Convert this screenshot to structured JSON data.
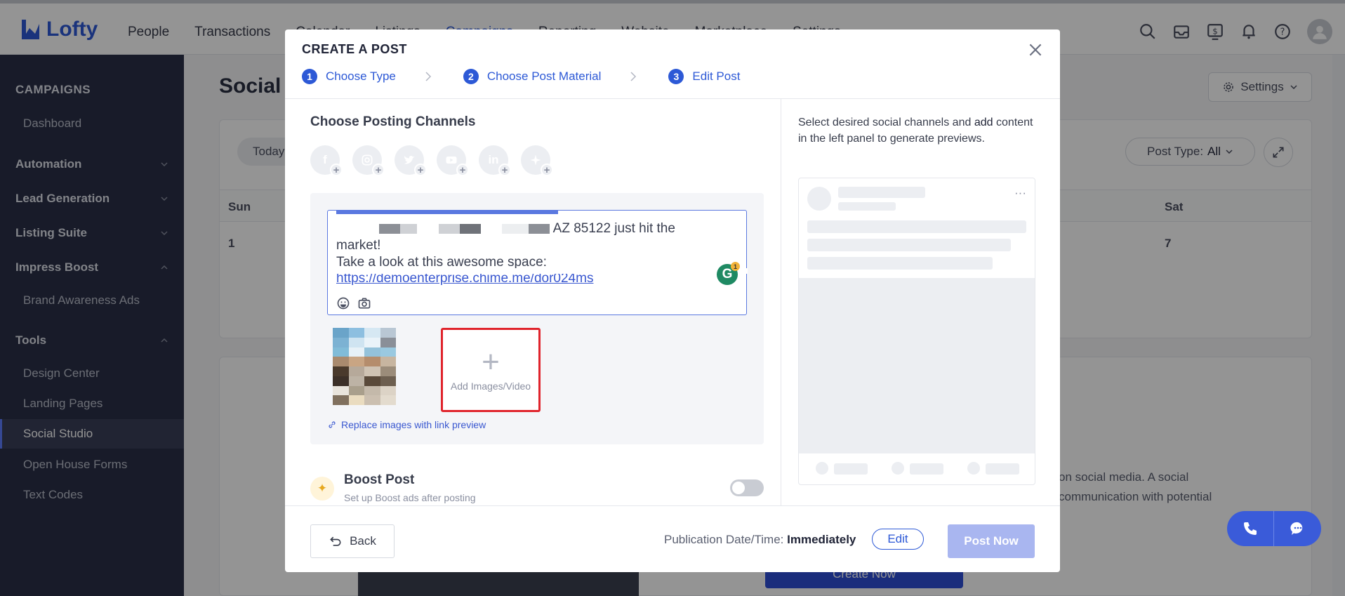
{
  "app": {
    "brand": "Lofty"
  },
  "nav": [
    "People",
    "Transactions",
    "Calendar",
    "Listings",
    "Campaigns",
    "Reporting",
    "Website",
    "Marketplace",
    "Settings"
  ],
  "sidebar": {
    "section": "CAMPAIGNS",
    "dashboard": "Dashboard",
    "automation": "Automation",
    "lead_generation": "Lead Generation",
    "listing_suite": "Listing Suite",
    "impress_boost": "Impress Boost",
    "brand_awareness": "Brand Awareness Ads",
    "tools": "Tools",
    "design_center": "Design Center",
    "landing_pages": "Landing Pages",
    "social_studio": "Social Studio",
    "open_house": "Open House Forms",
    "text_codes": "Text Codes"
  },
  "background": {
    "page_title": "Social",
    "settings": "Settings",
    "today": "Today",
    "post_type_label": "Post Type:",
    "post_type_value": "All",
    "day_sun": "Sun",
    "day_sat": "Sat",
    "date_1": "1",
    "date_7": "7",
    "desc_line1": "on social media. A social",
    "desc_line2": "communication with potential",
    "create_now": "Create Now"
  },
  "modal": {
    "title": "CREATE A POST",
    "steps": [
      {
        "num": "1",
        "label": "Choose Type"
      },
      {
        "num": "2",
        "label": "Choose Post Material"
      },
      {
        "num": "3",
        "label": "Edit Post"
      }
    ],
    "channels_title": "Choose Posting Channels",
    "post_text_tail": "AZ 85122 just hit the",
    "post_text_line2": "market!",
    "post_text_line3": "Take a look at this awesome space:",
    "post_link": "https://demoenterprise.chime.me/dor024ms",
    "grammarly_count": "1",
    "add_media": "Add Images/Video",
    "replace_link": "Replace images with link preview",
    "boost_title": "Boost Post",
    "boost_sub": "Set up Boost ads after posting",
    "right_info_pre": "Select desired social channels and ",
    "right_info_bold": "add",
    "right_info_post": " content in the left panel to generate previews.",
    "back": "Back",
    "pub_label": "Publication Date/Time: ",
    "pub_value": "Immediately",
    "edit": "Edit",
    "post_now": "Post Now"
  },
  "colors": {
    "accent": "#2d59d6",
    "highlight_red": "#e0242c",
    "sidebar_bg": "#2a2f47"
  }
}
